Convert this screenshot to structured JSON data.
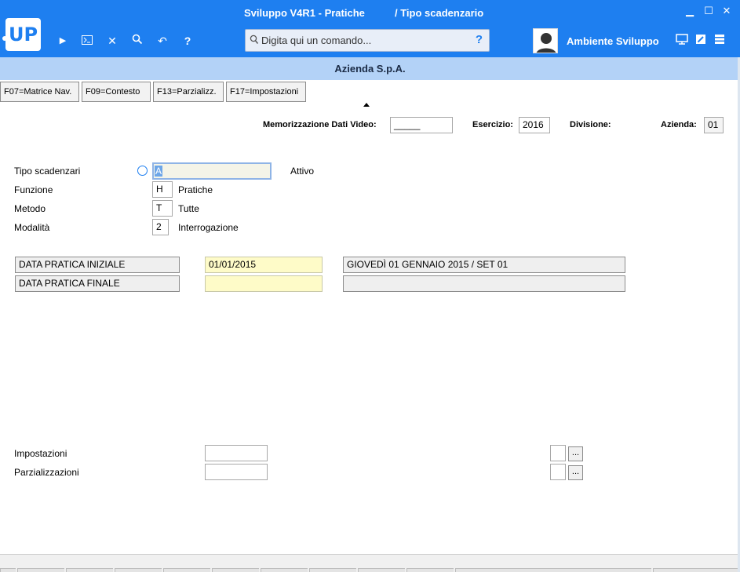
{
  "window": {
    "title_left": "Sviluppo V4R1 - Pratiche",
    "title_right": "/ Tipo scadenzario",
    "logo": "UP",
    "controls": {
      "minimize": "▁",
      "maximize": "☐",
      "close": "✕"
    }
  },
  "toolbar": {
    "icons": [
      "play-icon",
      "console-icon",
      "close-icon",
      "search-icon",
      "undo-icon",
      "help-icon"
    ],
    "play": "▶",
    "close": "✕",
    "undo": "↶",
    "help": "?"
  },
  "command": {
    "placeholder": "Digita qui un comando...",
    "help": "?"
  },
  "user": {
    "environment": "Ambiente Sviluppo"
  },
  "company": {
    "name": "Azienda S.p.A."
  },
  "function_keys": [
    {
      "label": "F07=Matrice Nav."
    },
    {
      "label": "F09=Contesto"
    },
    {
      "label": "F13=Parzializz."
    },
    {
      "label": "F17=Impostazioni"
    }
  ],
  "header": {
    "memorizzazione_label": "Memorizzazione Dati Video:",
    "memorizzazione_value": "_____",
    "esercizio_label": "Esercizio:",
    "esercizio_value": "2016",
    "divisione_label": "Divisione:",
    "azienda_label": "Azienda:",
    "azienda_value": "01"
  },
  "form": {
    "tipo_scadenzari": {
      "label": "Tipo scadenzari",
      "value": "A",
      "description": "Attivo"
    },
    "funzione": {
      "label": "Funzione",
      "value": "H",
      "description": "Pratiche"
    },
    "metodo": {
      "label": "Metodo",
      "value": "T",
      "description": "Tutte"
    },
    "modalita": {
      "label": "Modalità",
      "value": "2",
      "description": "Interrogazione"
    }
  },
  "date_range": {
    "initial": {
      "label": "DATA PRATICA INIZIALE",
      "value": "01/01/2015",
      "description": "GIOVEDÌ 01 GENNAIO 2015 / SET 01"
    },
    "final": {
      "label": "DATA PRATICA FINALE",
      "value": "",
      "description": ""
    }
  },
  "footer": {
    "impostazioni": {
      "label": "Impostazioni",
      "value": "",
      "code": "",
      "button": "..."
    },
    "parzializzazioni": {
      "label": "Parzializzazioni",
      "value": "",
      "code": "",
      "button": "..."
    }
  },
  "colors": {
    "titlebar": "#1e7ff0",
    "company_bar": "#b3d2f7",
    "input_yellow": "#fefbc8"
  }
}
